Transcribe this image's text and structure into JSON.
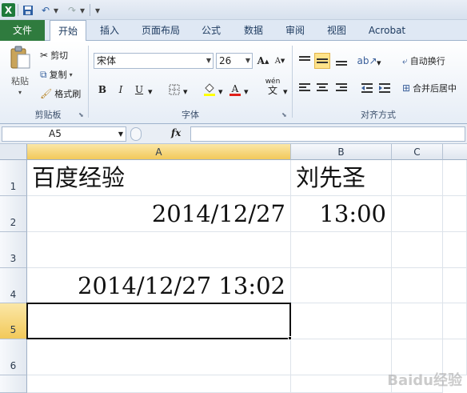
{
  "app": {
    "logo_letter": "X"
  },
  "ribbon_tabs": [
    "文件",
    "开始",
    "插入",
    "页面布局",
    "公式",
    "数据",
    "审阅",
    "视图",
    "Acrobat"
  ],
  "clipboard": {
    "paste": "粘贴",
    "cut": "剪切",
    "copy": "复制",
    "format_painter": "格式刷",
    "group_label": "剪贴板"
  },
  "font": {
    "name": "宋体",
    "size": "26",
    "bold": "B",
    "italic": "I",
    "underline": "U",
    "group_label": "字体",
    "grow": "A",
    "shrink": "A",
    "font_color": "A",
    "phonetic": "wén"
  },
  "alignment": {
    "wrap_text": "自动换行",
    "merge_center": "合并后居中",
    "group_label": "对齐方式"
  },
  "formula_bar": {
    "name_box": "A5",
    "fx": "fx",
    "formula": ""
  },
  "columns": [
    "A",
    "B",
    "C"
  ],
  "rows": [
    "1",
    "2",
    "3",
    "4",
    "5",
    "6"
  ],
  "cells": {
    "A1": "百度经验",
    "B1": "刘先圣",
    "A2": "2014/12/27",
    "B2": "13:00",
    "A4": "2014/12/27 13:02"
  },
  "watermark": "Baidu经验",
  "colors": {
    "file_tab": "#2f7b3e",
    "selection_header": "#f2c95a"
  }
}
